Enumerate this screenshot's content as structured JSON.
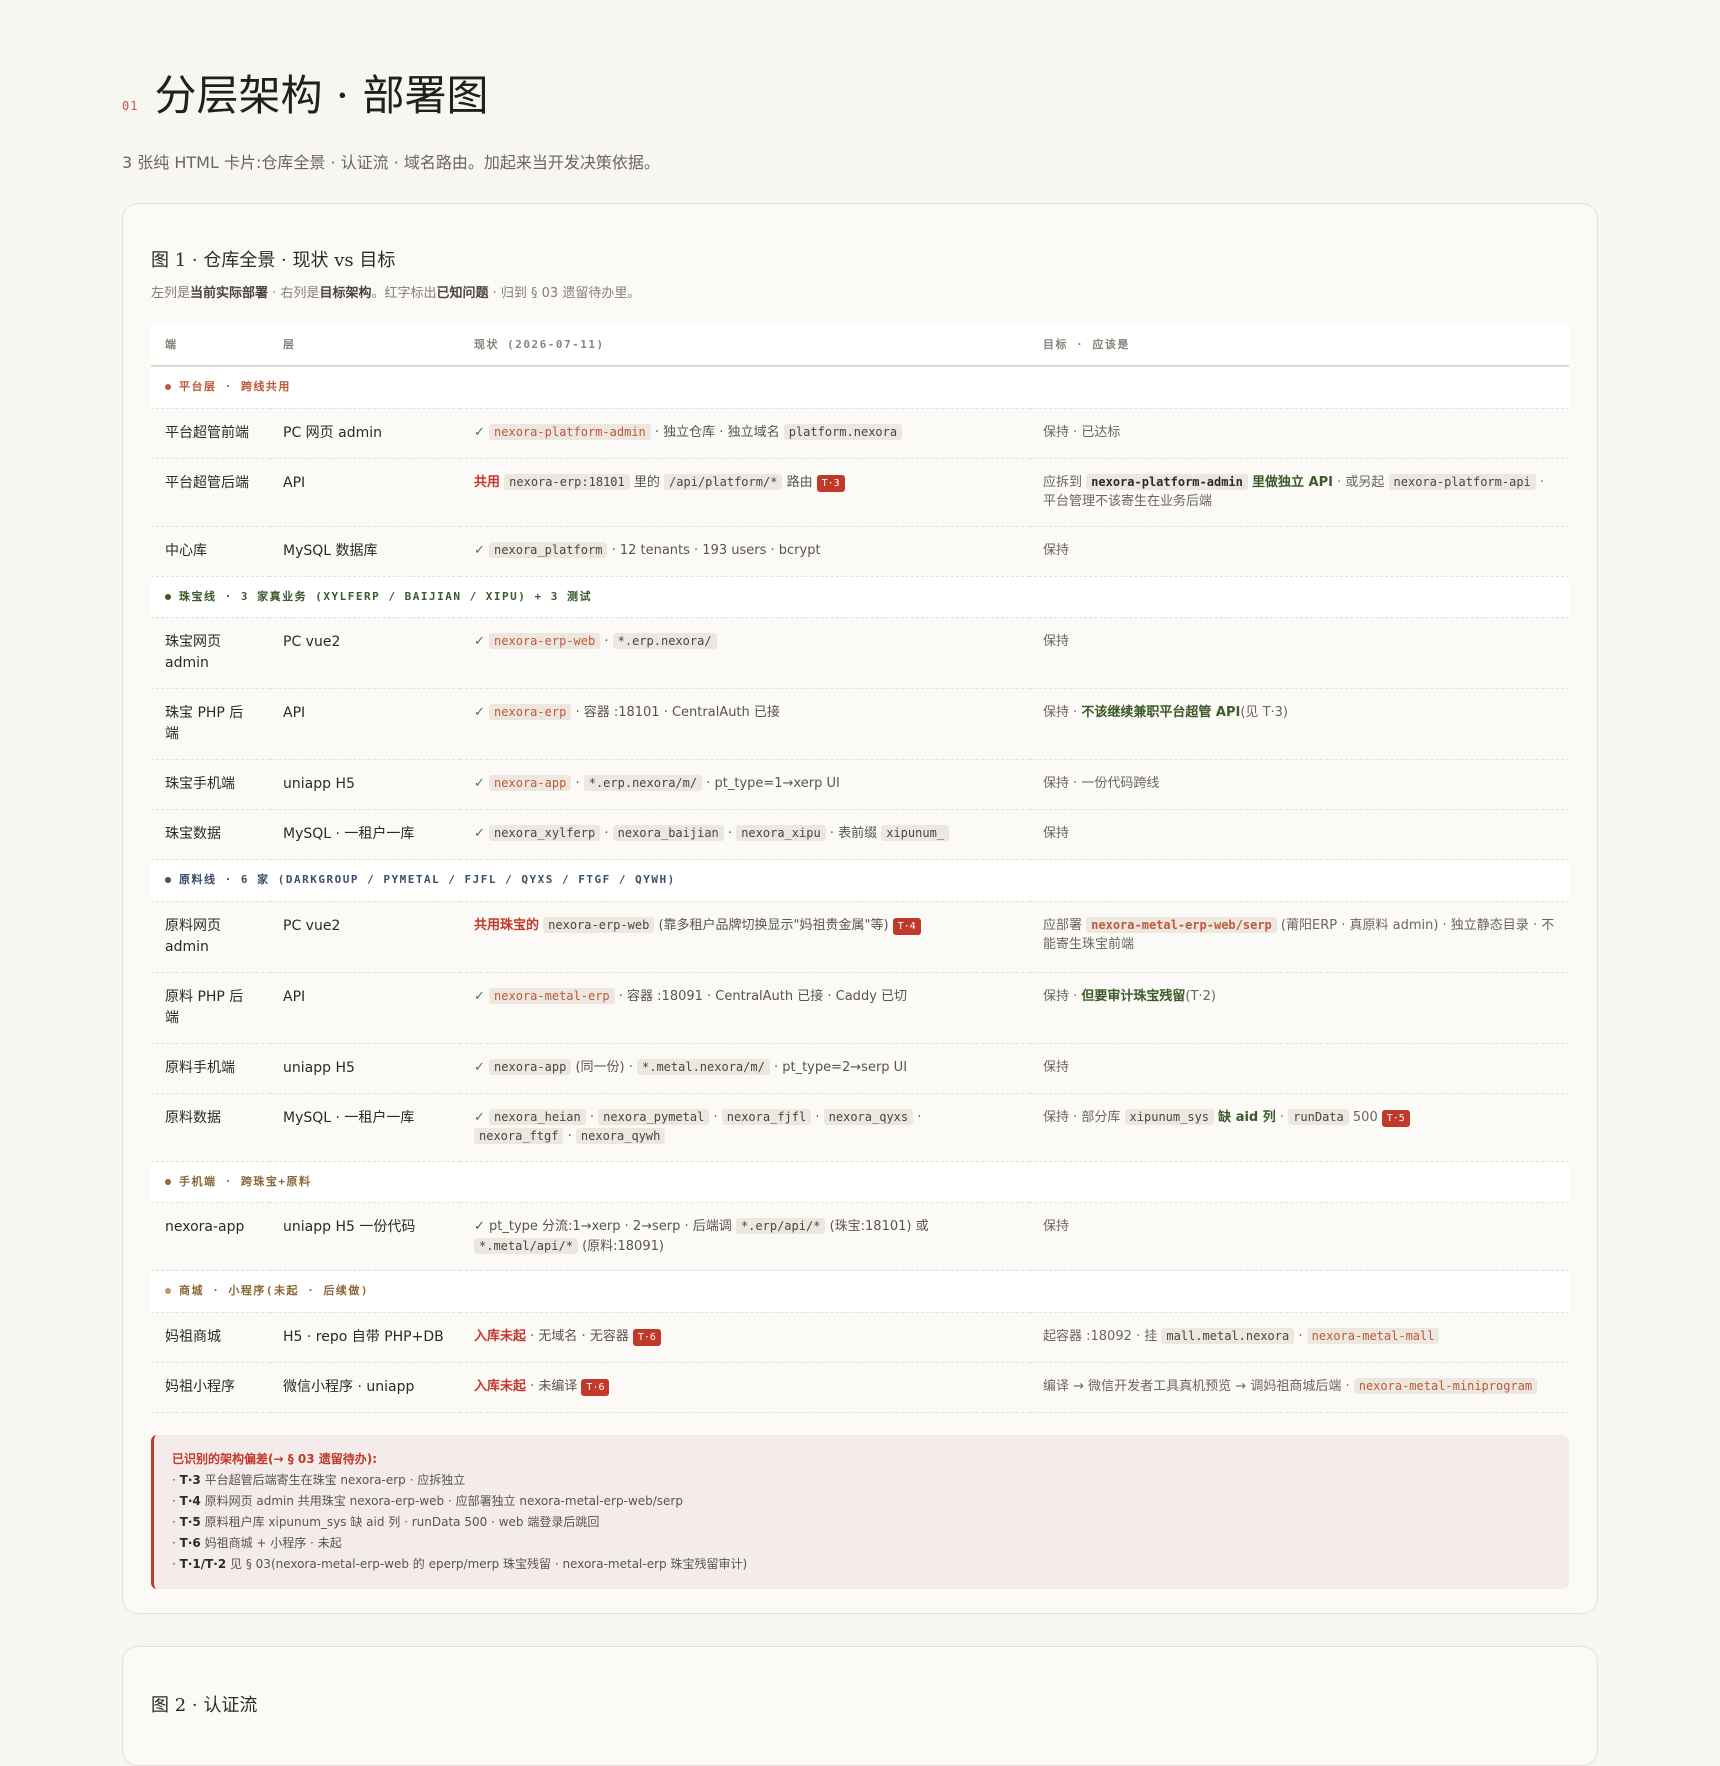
{
  "section": {
    "num": "01",
    "title": "分层架构 · 部署图",
    "lead": "3 张纯 HTML 卡片:仓库全景 · 认证流 · 域名路由。加起来当开发决策依据。"
  },
  "fig1": {
    "title": "图 1 · 仓库全景 · 现状 vs 目标",
    "sub_a": "左列是",
    "sub_b": "当前实际部署",
    "sub_c": " · 右列是",
    "sub_d": "目标架构",
    "sub_e": "。红字标出",
    "sub_f": "已知问题",
    "sub_g": " · 归到 § 03 遗留待办里。",
    "headers": [
      "端",
      "层",
      "现状 (2026-07-11)",
      "目标 · 应该是"
    ],
    "groups": {
      "platform": "平台层 · 跨线共用",
      "jewelry": "珠宝线 · 3 家真业务 (XYLFERP / BAIJIAN / XIPU) + 3 测试",
      "metal": "原料线 · 6 家 (DARKGROUP / PYMETAL / FJFL / QYXS / FTGF / QYWH)",
      "mobile": "手机端 · 跨珠宝+原料",
      "mall": "商城 · 小程序(未起 · 后续做)"
    },
    "rows": {
      "r1": {
        "c1": "平台超管前端",
        "c2": "PC 网页 admin",
        "ok": "✓",
        "code1": "nexora-platform-admin",
        "t1": "· 独立仓库 · 独立域名",
        "code2": "platform.nexora",
        "c4": "保持 · 已达标"
      },
      "r2": {
        "c1": "平台超管后端",
        "c2": "API",
        "warn": "共用",
        "code1": "nexora-erp:18101",
        "t1": "里的",
        "code2": "/api/platform/*",
        "t2": "路由",
        "tag": "T·3",
        "t4a": "应拆到",
        "code3": "nexora-platform-admin",
        "t4b": "里做独立 API",
        "t4c": "· 或另起",
        "code4": "nexora-platform-api",
        "t4d": "· 平台管理不该寄生在业务后端"
      },
      "r3": {
        "c1": "中心库",
        "c2": "MySQL 数据库",
        "ok": "✓",
        "code1": "nexora_platform",
        "t1": "· 12 tenants · 193 users · bcrypt",
        "c4": "保持"
      },
      "r4": {
        "c1": "珠宝网页 admin",
        "c2": "PC vue2",
        "ok": "✓",
        "code1": "nexora-erp-web",
        "t1": "·",
        "code2": "*.erp.nexora/",
        "c4": "保持"
      },
      "r5": {
        "c1": "珠宝 PHP 后端",
        "c2": "API",
        "ok": "✓",
        "code1": "nexora-erp",
        "t1": "· 容器 :18101 · CentralAuth 已接",
        "t4a": "保持 ·",
        "t4b": "不该继续兼职平台超管 API",
        "t4c": "(见 T·3)"
      },
      "r6": {
        "c1": "珠宝手机端",
        "c2": "uniapp H5",
        "ok": "✓",
        "code1": "nexora-app",
        "t1": "·",
        "code2": "*.erp.nexora/m/",
        "t2": "· pt_type=1→xerp UI",
        "c4": "保持 · 一份代码跨线"
      },
      "r7": {
        "c1": "珠宝数据",
        "c2": "MySQL · 一租户一库",
        "ok": "✓",
        "code1": "nexora_xylferp",
        "t1": "·",
        "code2": "nexora_baijian",
        "t2": "·",
        "code3": "nexora_xipu",
        "t3": "· 表前缀",
        "code4": "xipunum_",
        "c4": "保持"
      },
      "r8": {
        "c1": "原料网页 admin",
        "c2": "PC vue2",
        "warn": "共用珠宝的",
        "code1": "nexora-erp-web",
        "t1": "(靠多租户品牌切换显示\"妈祖贵金属\"等)",
        "tag": "T·4",
        "t4a": "应部署",
        "code2": "nexora-metal-erp-web/serp",
        "t4b": "(莆阳ERP · 真原料 admin) · 独立静态目录 · 不能寄生珠宝前端"
      },
      "r9": {
        "c1": "原料 PHP 后端",
        "c2": "API",
        "ok": "✓",
        "code1": "nexora-metal-erp",
        "t1": "· 容器 :18091 · CentralAuth 已接 · Caddy 已切",
        "t4a": "保持 ·",
        "t4b": "但要审计珠宝残留",
        "t4c": "(T·2)"
      },
      "r10": {
        "c1": "原料手机端",
        "c2": "uniapp H5",
        "ok": "✓",
        "code1": "nexora-app",
        "t1": "(同一份) ·",
        "code2": "*.metal.nexora/m/",
        "t2": "· pt_type=2→serp UI",
        "c4": "保持"
      },
      "r11": {
        "c1": "原料数据",
        "c2": "MySQL · 一租户一库",
        "ok": "✓",
        "code1": "nexora_heian",
        "code2": "nexora_pymetal",
        "code3": "nexora_fjfl",
        "code4": "nexora_qyxs",
        "code5": "nexora_ftgf",
        "code6": "nexora_qywh",
        "sep": "·",
        "t4a": "保持 · 部分库",
        "c4code1": "xipunum_sys",
        "t4b": "缺 aid 列",
        "t4c": "·",
        "c4code2": "runData",
        "t4d": "500",
        "tag": "T·5"
      },
      "r12": {
        "c1": "nexora-app",
        "c2": "uniapp H5 一份代码",
        "t1": "✓ pt_type 分流:1→xerp · 2→serp · 后端调",
        "code1": "*.erp/api/*",
        "t2": "(珠宝:18101) 或",
        "code2": "*.metal/api/*",
        "t3": "(原料:18091)",
        "c4": "保持"
      },
      "r13": {
        "c1": "妈祖商城",
        "c2": "H5 · repo 自带 PHP+DB",
        "warn": "入库未起",
        "t1": "· 无域名 · 无容器",
        "tag": "T·6",
        "t4a": "起容器 :18092 · 挂",
        "code1": "mall.metal.nexora",
        "t4b": "·",
        "code2": "nexora-metal-mall"
      },
      "r14": {
        "c1": "妈祖小程序",
        "c2": "微信小程序 · uniapp",
        "warn": "入库未起",
        "t1": "· 未编译",
        "tag": "T·6",
        "t4a": "编译 → 微信开发者工具真机预览 → 调妈祖商城后端 ·",
        "code1": "nexora-metal-miniprogram"
      }
    },
    "notes": {
      "title": "已识别的架构偏差(→ § 03 遗留待办):",
      "items": [
        {
          "k": "T·3",
          "v": "平台超管后端寄生在珠宝 nexora-erp · 应拆独立"
        },
        {
          "k": "T·4",
          "v": "原料网页 admin 共用珠宝 nexora-erp-web · 应部署独立 nexora-metal-erp-web/serp"
        },
        {
          "k": "T·5",
          "v": "原料租户库 xipunum_sys 缺 aid 列 · runData 500 · web 端登录后跳回"
        },
        {
          "k": "T·6",
          "v": "妈祖商城 + 小程序 · 未起"
        },
        {
          "k": "T·1/T·2",
          "v": "见 § 03(nexora-metal-erp-web 的 eperp/merp 珠宝残留 · nexora-metal-erp 珠宝残留审计)"
        }
      ]
    }
  },
  "fig2": {
    "title": "图 2 · 认证流"
  },
  "colors": {
    "accent": "#c0583a",
    "warn": "#c0392b",
    "good": "#3c5a2a",
    "jewelry": "#3c5a2a",
    "metal": "#3a4f6b",
    "mall": "#8a6a3a"
  }
}
